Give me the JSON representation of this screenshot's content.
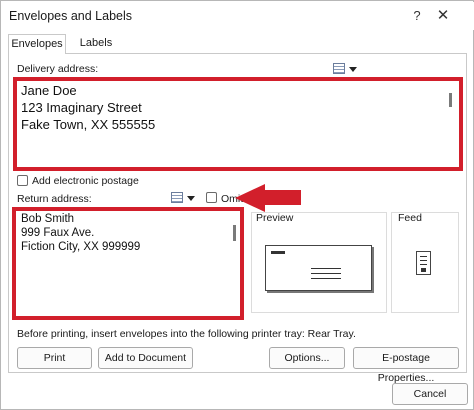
{
  "window": {
    "title": "Envelopes and Labels",
    "help_glyph": "?",
    "close_glyph": "✕"
  },
  "tabs": [
    {
      "label": "Envelopes",
      "active": true
    },
    {
      "label": "Labels",
      "active": false
    }
  ],
  "delivery": {
    "label": "Delivery address:",
    "lines": [
      "Jane Doe",
      "123 Imaginary Street",
      "Fake Town, XX 555555"
    ]
  },
  "electronic_postage": {
    "label": "Add electronic postage",
    "checked": false
  },
  "return_address": {
    "label": "Return address:",
    "lines": [
      "Bob Smith",
      "999 Faux Ave.",
      "Fiction City, XX 999999"
    ]
  },
  "omit": {
    "label": "Omit",
    "checked": false
  },
  "preview": {
    "label": "Preview"
  },
  "feed": {
    "label": "Feed"
  },
  "printer_note": "Before printing, insert envelopes into the following printer tray: Rear Tray.",
  "buttons": {
    "print": "Print",
    "add_to_document": "Add to Document",
    "options": "Options...",
    "epostage": "E-postage Properties...",
    "cancel": "Cancel"
  },
  "icons": {
    "address_book": "address-book-icon",
    "dropdown": "chevron-down-icon",
    "callout_arrow": "arrow-left-icon"
  },
  "colors": {
    "highlight_red": "#d21f2b"
  }
}
